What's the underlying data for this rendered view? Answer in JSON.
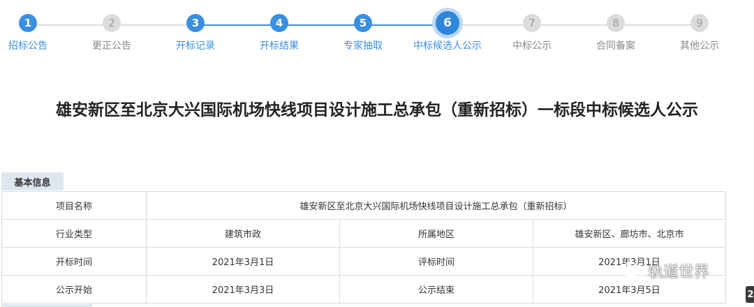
{
  "stepper": {
    "steps": [
      {
        "num": "1",
        "label": "招标公告",
        "state": "done"
      },
      {
        "num": "2",
        "label": "更正公告",
        "state": "todo"
      },
      {
        "num": "3",
        "label": "开标记录",
        "state": "done"
      },
      {
        "num": "4",
        "label": "开标结果",
        "state": "done"
      },
      {
        "num": "5",
        "label": "专家抽取",
        "state": "done"
      },
      {
        "num": "6",
        "label": "中标候选人公示",
        "state": "current"
      },
      {
        "num": "7",
        "label": "中标公示",
        "state": "todo"
      },
      {
        "num": "8",
        "label": "合同备案",
        "state": "todo"
      },
      {
        "num": "9",
        "label": "其他公示",
        "state": "todo"
      }
    ],
    "colors": {
      "done": "#3b8fe0",
      "todo": "#dcdcdc"
    }
  },
  "title": "雄安新区至北京大兴国际机场快线项目设计施工总承包（重新招标）一标段中标候选人公示",
  "info": {
    "section_label": "基本信息",
    "project_name_label": "项目名称",
    "project_name_value": "雄安新区至北京大兴国际机场快线项目设计施工总承包（重新招标）",
    "industry_label": "行业类型",
    "industry_value": "建筑市政",
    "region_label": "所属地区",
    "region_value": "雄安新区、廊坊市、北京市",
    "open_time_label": "开标时间",
    "open_time_value": "2021年3月1日",
    "eval_time_label": "评标时间",
    "eval_time_value": "2021年3月1日",
    "publish_start_label": "公示开始",
    "publish_start_value": "2021年3月3日",
    "publish_end_label": "公示结束",
    "publish_end_value": "2021年3月5日"
  },
  "watermark": {
    "text": "轨道世界",
    "icon": "wechat-icon"
  },
  "edge_badge": "2"
}
